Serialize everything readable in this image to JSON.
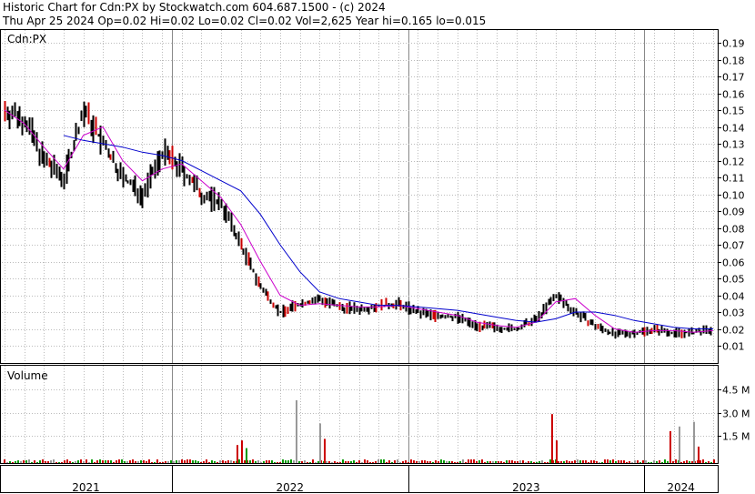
{
  "header": {
    "line1": "Historic Chart for Cdn:PX by Stockwatch.com 604.687.1500 - (c) 2024",
    "line2": "Thu Apr 25 2024  Op=0.02  Hi=0.02  Lo=0.02  Cl=0.02  Vol=2,625  Year hi=0.165  lo=0.015"
  },
  "price_panel": {
    "label": "Cdn:PX"
  },
  "volume_panel": {
    "label": "Volume"
  },
  "chart_data": [
    {
      "type": "line",
      "title": "Cdn:PX",
      "ylim": [
        0.0,
        0.2
      ],
      "y_ticks": [
        "0.19",
        "0.18",
        "0.17",
        "0.16",
        "0.15",
        "0.14",
        "0.13",
        "0.12",
        "0.11",
        "0.10",
        "0.09",
        "0.08",
        "0.07",
        "0.06",
        "0.05",
        "0.04",
        "0.03",
        "0.02",
        "0.01"
      ],
      "x_labels": [
        "2021",
        "2022",
        "2023",
        "2024"
      ],
      "x": [
        "2021-04",
        "2021-05",
        "2021-06",
        "2021-07",
        "2021-08",
        "2021-09",
        "2021-10",
        "2021-11",
        "2021-12",
        "2022-01",
        "2022-02",
        "2022-03",
        "2022-04",
        "2022-05",
        "2022-06",
        "2022-07",
        "2022-08",
        "2022-09",
        "2022-10",
        "2022-11",
        "2022-12",
        "2023-01",
        "2023-02",
        "2023-03",
        "2023-04",
        "2023-05",
        "2023-06",
        "2023-07",
        "2023-08",
        "2023-09",
        "2023-10",
        "2023-11",
        "2023-12",
        "2024-01",
        "2024-02",
        "2024-03",
        "2024-04"
      ],
      "series": [
        {
          "color": "#000000",
          "values": [
            0.15,
            0.145,
            0.12,
            0.11,
            0.15,
            0.13,
            0.11,
            0.1,
            0.125,
            0.115,
            0.1,
            0.095,
            0.07,
            0.045,
            0.03,
            0.035,
            0.038,
            0.033,
            0.032,
            0.034,
            0.035,
            0.03,
            0.028,
            0.027,
            0.022,
            0.021,
            0.02,
            0.026,
            0.04,
            0.03,
            0.022,
            0.017,
            0.018,
            0.02,
            0.018,
            0.018,
            0.02
          ]
        },
        {
          "color": "#cc00cc",
          "values": [
            0.15,
            0.142,
            0.128,
            0.115,
            0.135,
            0.14,
            0.12,
            0.108,
            0.115,
            0.118,
            0.108,
            0.098,
            0.082,
            0.06,
            0.04,
            0.034,
            0.035,
            0.034,
            0.033,
            0.033,
            0.034,
            0.032,
            0.03,
            0.028,
            0.024,
            0.022,
            0.021,
            0.024,
            0.036,
            0.038,
            0.028,
            0.02,
            0.018,
            0.019,
            0.019,
            0.018,
            0.019
          ]
        },
        {
          "color": "#0000cc",
          "values": [
            null,
            null,
            null,
            0.135,
            0.132,
            0.13,
            0.128,
            0.125,
            0.123,
            0.12,
            0.114,
            0.108,
            0.102,
            0.088,
            0.07,
            0.054,
            0.042,
            0.038,
            0.036,
            0.034,
            0.034,
            0.033,
            0.032,
            0.031,
            0.029,
            0.027,
            0.025,
            0.024,
            0.026,
            0.03,
            0.03,
            0.028,
            0.025,
            0.023,
            0.021,
            0.02,
            0.02
          ]
        }
      ]
    },
    {
      "type": "bar",
      "title": "Volume",
      "ylim": [
        0,
        5.5
      ],
      "y_ticks": [
        "4.5 M",
        "3.0 M",
        "1.5 M"
      ],
      "units": "M",
      "bars": [
        {
          "x": "2022-04",
          "value": 0.9,
          "color": "#cc0000"
        },
        {
          "x": "2022-04",
          "value": 1.2,
          "color": "#cc0000"
        },
        {
          "x": "2022-04",
          "value": 0.7,
          "color": "#009900"
        },
        {
          "x": "2022-07",
          "value": 3.8,
          "color": "#999999"
        },
        {
          "x": "2022-08",
          "value": 2.3,
          "color": "#999999"
        },
        {
          "x": "2022-08",
          "value": 1.3,
          "color": "#cc0000"
        },
        {
          "x": "2023-08",
          "value": 2.9,
          "color": "#cc0000"
        },
        {
          "x": "2023-08",
          "value": 1.2,
          "color": "#cc0000"
        },
        {
          "x": "2024-02",
          "value": 2.1,
          "color": "#999999"
        },
        {
          "x": "2024-02",
          "value": 1.8,
          "color": "#cc0000"
        },
        {
          "x": "2024-03",
          "value": 2.4,
          "color": "#999999"
        },
        {
          "x": "2024-03",
          "value": 0.8,
          "color": "#cc0000"
        }
      ]
    }
  ]
}
